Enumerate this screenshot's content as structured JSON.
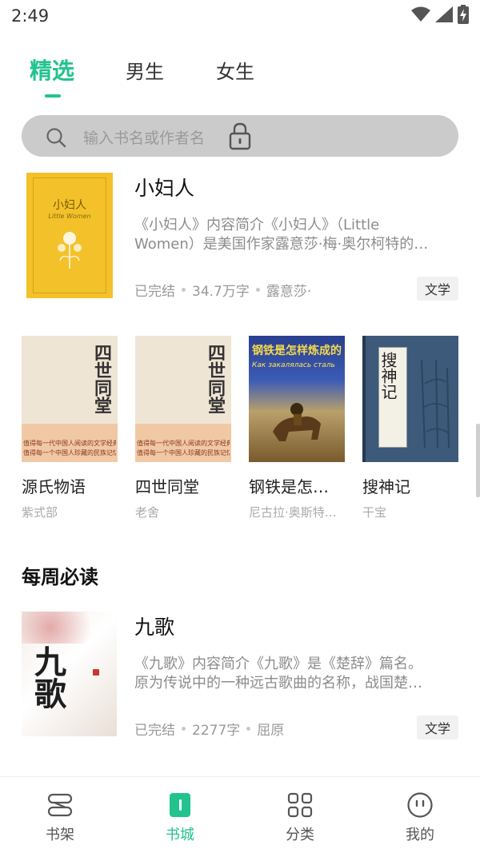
{
  "status": {
    "time": "2:49"
  },
  "tabs": [
    {
      "label": "精选",
      "active": true
    },
    {
      "label": "男生",
      "active": false
    },
    {
      "label": "女生",
      "active": false
    }
  ],
  "search": {
    "placeholder": "输入书名或作者名"
  },
  "featured": {
    "title": "小妇人",
    "desc_line1": "《小妇人》内容简介《小妇人》（Little",
    "desc_line2": "Women）是美国作家露意莎·梅·奥尔柯特的…",
    "status": "已完结",
    "words": "34.7万字",
    "author": "露意莎·",
    "tag": "文学",
    "cover_title": "小妇人",
    "cover_subtitle": "Little Women"
  },
  "grid": [
    {
      "title": "源氏物语",
      "author": "紫式部"
    },
    {
      "title": "四世同堂",
      "author": "老舍"
    },
    {
      "title": "钢铁是怎…",
      "author": "尼古拉·奥斯特…"
    },
    {
      "title": "搜神记",
      "author": "干宝"
    }
  ],
  "cover_text": {
    "sishi": "四世同堂",
    "sishi_lines": [
      "值得每一代中国人阅读的文学经典",
      "值得每一个中国人珍藏的民族记忆"
    ],
    "gangtie_cn": "钢铁是怎样炼成的",
    "gangtie_ru": "Как закалялась сталь",
    "soushen": "搜神记",
    "jiuge": "九歌"
  },
  "weekly": {
    "section_title": "每周必读",
    "title": "九歌",
    "desc_line1": "《九歌》内容简介《九歌》是《楚辞》篇名。",
    "desc_line2": "原为传说中的一种远古歌曲的名称，战国楚…",
    "status": "已完结",
    "words": "2277字",
    "author": "屈原",
    "tag": "文学"
  },
  "nav": [
    {
      "label": "书架",
      "icon": "bookshelf-icon",
      "active": false
    },
    {
      "label": "书城",
      "icon": "bookstore-icon",
      "active": true
    },
    {
      "label": "分类",
      "icon": "category-icon",
      "active": false
    },
    {
      "label": "我的",
      "icon": "profile-icon",
      "active": false
    }
  ],
  "colors": {
    "accent": "#22c38e",
    "search_bg": "#cbcbcb",
    "muted_text": "#999999"
  }
}
